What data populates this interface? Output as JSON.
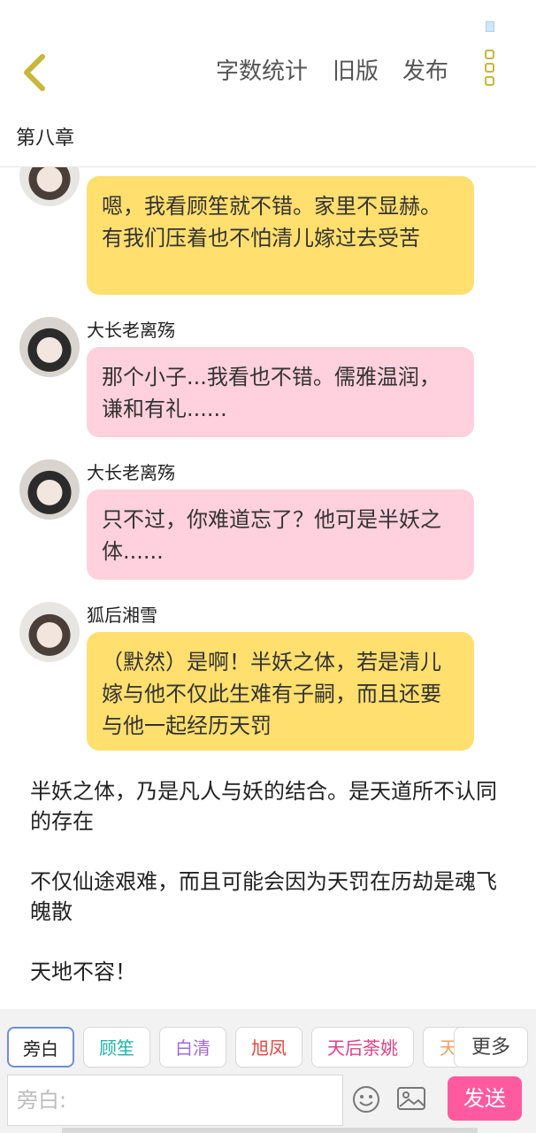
{
  "header": {
    "word_count": "字数统计",
    "old_version": "旧版",
    "publish": "发布"
  },
  "chapter": {
    "title": "第八章"
  },
  "messages": [
    {
      "type": "chat",
      "sender": "",
      "color": "yellow",
      "text": "嗯，我看顾笙就不错。家里不显赫。有我们压着也不怕清儿嫁过去受苦"
    },
    {
      "type": "chat",
      "sender": "大长老离殇",
      "color": "pink",
      "text": "那个小子...我看也不错。儒雅温润，谦和有礼......"
    },
    {
      "type": "chat",
      "sender": "大长老离殇",
      "color": "pink",
      "text": "只不过，你难道忘了？他可是半妖之体......"
    },
    {
      "type": "chat",
      "sender": "狐后湘雪",
      "color": "yellow",
      "text": "（默然）是啊！半妖之体，若是清儿嫁与他不仅此生难有子嗣，而且还要与他一起经历天罚"
    }
  ],
  "narration": [
    "半妖之体，乃是凡人与妖的结合。是天道所不认同的存在",
    "不仅仙途艰难，而且可能会因为天罚在历劫是魂飞魄散",
    "天地不容！"
  ],
  "roles": [
    {
      "name": "旁白",
      "color": "#555555"
    },
    {
      "name": "顾笙",
      "color": "#1fb5a8"
    },
    {
      "name": "白清",
      "color": "#a16ad6"
    },
    {
      "name": "旭凤",
      "color": "#e2453c"
    },
    {
      "name": "天后荼姚",
      "color": "#e0408a"
    },
    {
      "name": "天",
      "color": "#f0a060"
    }
  ],
  "composer": {
    "more": "更多",
    "placeholder": "旁白:",
    "send": "发送"
  },
  "colors": {
    "accent": "#ff5aa0",
    "bubble_yellow": "#ffdf6e",
    "bubble_pink": "#ffd0de",
    "back_icon": "#c9b63a"
  }
}
